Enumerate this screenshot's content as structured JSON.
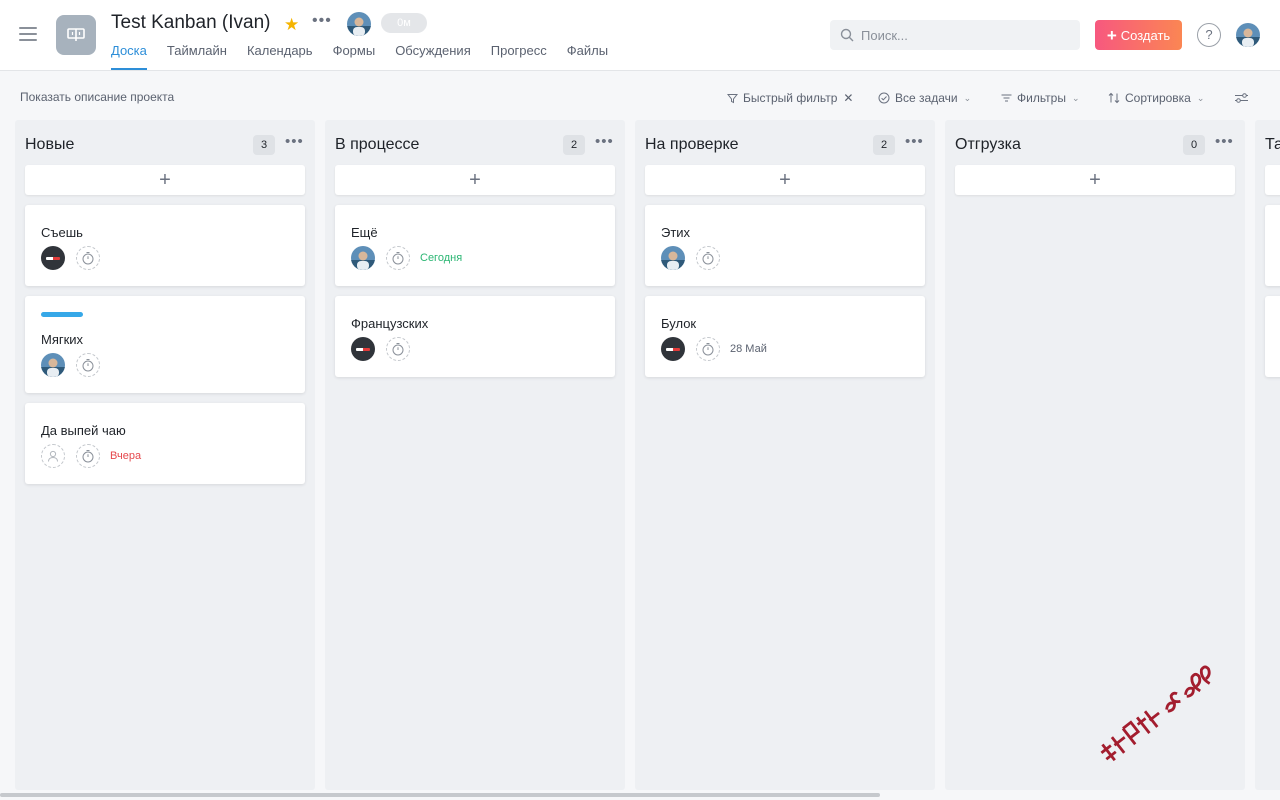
{
  "header": {
    "project_title": "Test Kanban (Ivan)",
    "timer": "0м",
    "tabs": [
      "Доска",
      "Таймлайн",
      "Календарь",
      "Формы",
      "Обсуждения",
      "Прогресс",
      "Файлы"
    ],
    "active_tab": "Доска",
    "search_placeholder": "Поиск...",
    "create_label": "Создать",
    "help_label": "?"
  },
  "toolbar": {
    "project_description": "Показать описание проекта",
    "quick_filter": "Быстрый фильтр",
    "all_tasks": "Все задачи",
    "filters": "Фильтры",
    "sort": "Сортировка"
  },
  "columns": [
    {
      "title": "Новые",
      "count": "3",
      "cards": [
        {
          "title": "Съешь",
          "assignee": "dark-logo-avatar",
          "due": ""
        },
        {
          "title": "Мягких",
          "assignee": "photo-avatar",
          "label_color": "#36a8e8",
          "due": ""
        },
        {
          "title": "Да выпей чаю",
          "assignee": "empty-avatar",
          "due": "Вчера",
          "due_color": "#e5484d"
        }
      ]
    },
    {
      "title": "В процессе",
      "count": "2",
      "cards": [
        {
          "title": "Ещё",
          "assignee": "photo-avatar",
          "due": "Сегодня",
          "due_color": "#2bb673"
        },
        {
          "title": "Французских",
          "assignee": "dark-logo-avatar",
          "due": ""
        }
      ]
    },
    {
      "title": "На проверке",
      "count": "2",
      "cards": [
        {
          "title": "Этих",
          "assignee": "photo-avatar",
          "due": ""
        },
        {
          "title": "Булок",
          "assignee": "dark-logo-avatar",
          "due": "28 Май",
          "due_color": "#5b6270"
        }
      ]
    },
    {
      "title": "Отгрузка",
      "count": "0",
      "cards": []
    }
  ],
  "partial_column": {
    "title": "Та"
  },
  "colors": {
    "accent": "#2d8ed8",
    "create_gradient_start": "#f7587f",
    "create_gradient_end": "#fb8653",
    "star": "#f5b400"
  },
  "watermark": "数创社scs66"
}
